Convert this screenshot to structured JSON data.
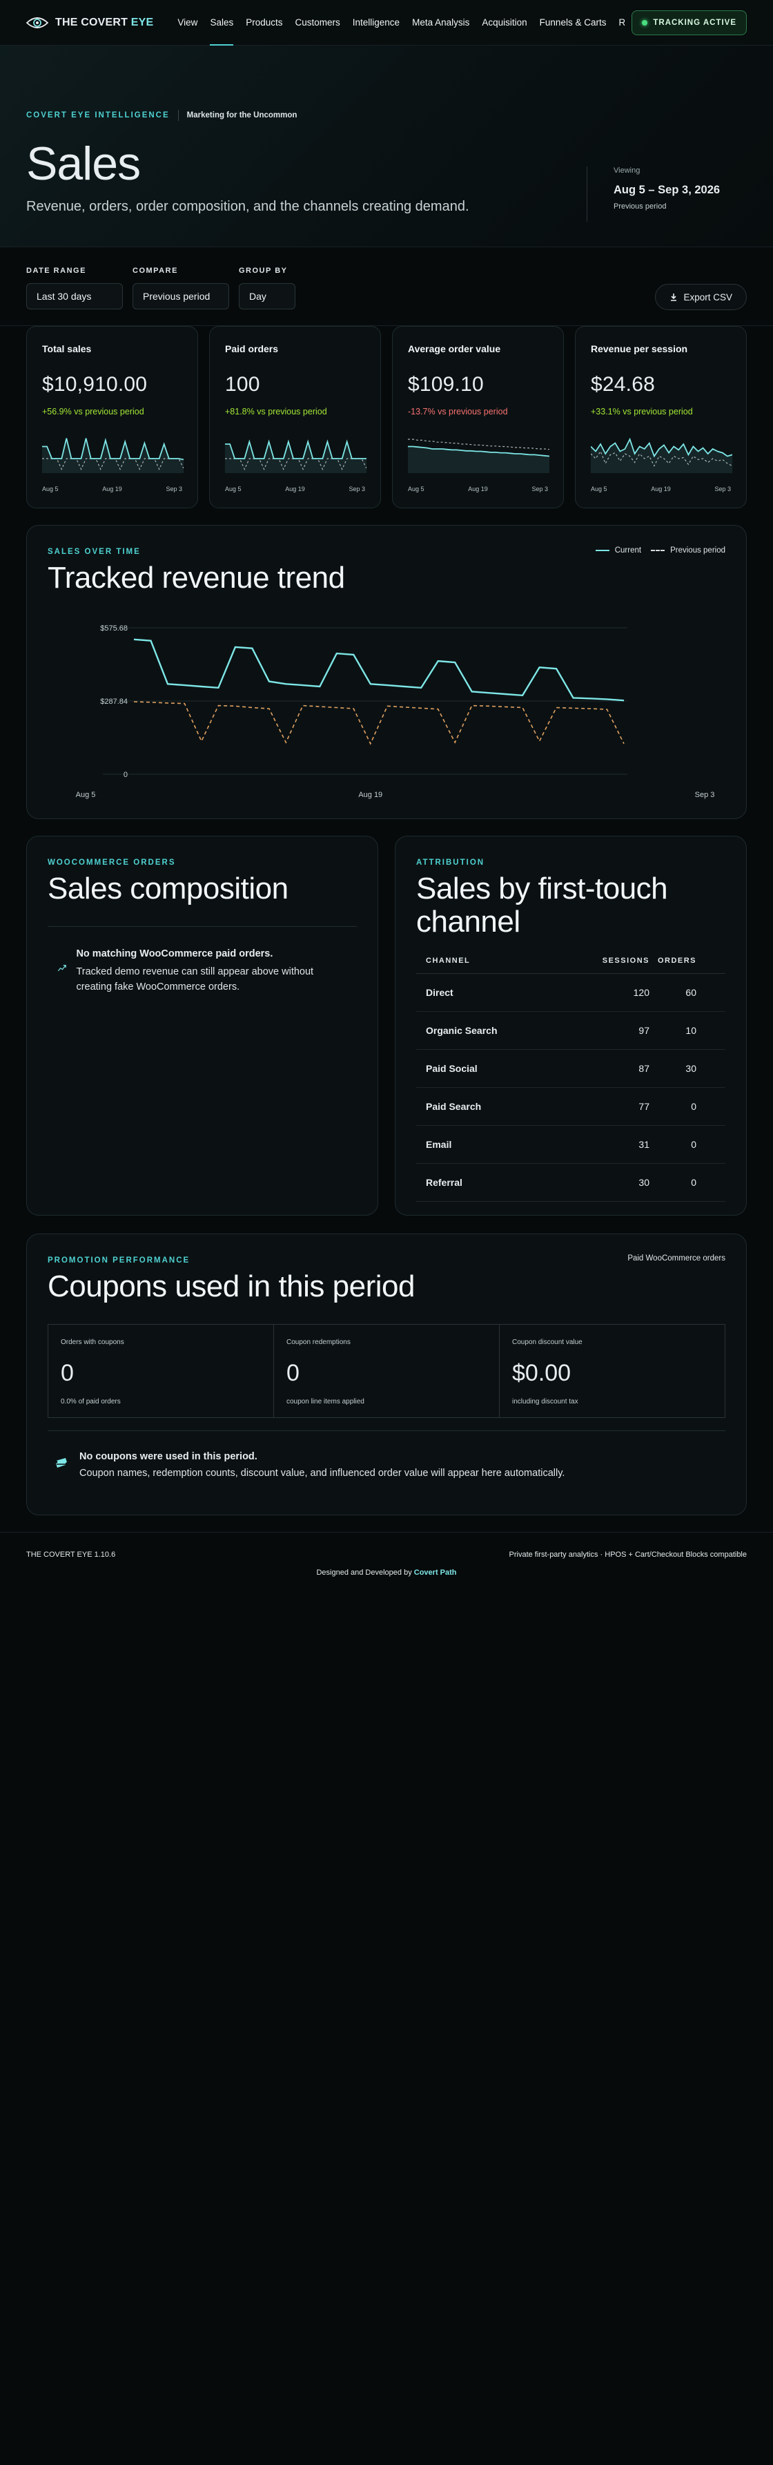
{
  "brand": {
    "name_a": "THE COVERT",
    "name_b": "EYE"
  },
  "nav": [
    "View",
    "Sales",
    "Products",
    "Customers",
    "Intelligence",
    "Meta Analysis",
    "Acquisition",
    "Funnels & Carts",
    "R"
  ],
  "nav_active": "Sales",
  "tracking_label": "TRACKING ACTIVE",
  "hero": {
    "eyebrow": "COVERT EYE INTELLIGENCE",
    "tagline": "Marketing for the Uncommon",
    "title": "Sales",
    "subtitle": "Revenue, orders, order composition, and the channels creating demand.",
    "viewing_label": "Viewing",
    "viewing_range": "Aug 5 – Sep 3, 2026",
    "viewing_compare": "Previous period"
  },
  "filters": {
    "date_range_label": "DATE RANGE",
    "date_range_value": "Last 30 days",
    "compare_label": "COMPARE",
    "compare_value": "Previous period",
    "group_by_label": "GROUP BY",
    "group_by_value": "Day",
    "export_label": "Export CSV"
  },
  "kpis": [
    {
      "title": "Total sales",
      "value": "$10,910.00",
      "delta": "+56.9% vs previous period",
      "trend": "up",
      "current": [
        0.55,
        0.55,
        0.3,
        0.3,
        0.3,
        0.72,
        0.3,
        0.3,
        0.3,
        0.72,
        0.3,
        0.3,
        0.3,
        0.68,
        0.3,
        0.3,
        0.3,
        0.65,
        0.3,
        0.3,
        0.3,
        0.62,
        0.3,
        0.3,
        0.3,
        0.6,
        0.3,
        0.3,
        0.3,
        0.28
      ],
      "previous": [
        0.3,
        0.3,
        0.3,
        0.3,
        0.08,
        0.3,
        0.3,
        0.3,
        0.08,
        0.3,
        0.3,
        0.3,
        0.08,
        0.3,
        0.3,
        0.3,
        0.08,
        0.3,
        0.3,
        0.3,
        0.08,
        0.3,
        0.3,
        0.3,
        0.08,
        0.3,
        0.3,
        0.3,
        0.3,
        0.1
      ]
    },
    {
      "title": "Paid orders",
      "value": "100",
      "delta": "+81.8% vs previous period",
      "trend": "up",
      "current": [
        0.6,
        0.6,
        0.3,
        0.3,
        0.3,
        0.65,
        0.3,
        0.3,
        0.3,
        0.65,
        0.3,
        0.3,
        0.3,
        0.65,
        0.3,
        0.3,
        0.3,
        0.65,
        0.3,
        0.3,
        0.3,
        0.65,
        0.3,
        0.3,
        0.3,
        0.65,
        0.3,
        0.3,
        0.3,
        0.3
      ],
      "previous": [
        0.3,
        0.3,
        0.3,
        0.3,
        0.08,
        0.3,
        0.3,
        0.3,
        0.08,
        0.3,
        0.3,
        0.3,
        0.08,
        0.3,
        0.3,
        0.3,
        0.08,
        0.3,
        0.3,
        0.3,
        0.08,
        0.3,
        0.3,
        0.3,
        0.08,
        0.3,
        0.3,
        0.3,
        0.3,
        0.1
      ]
    },
    {
      "title": "Average order value",
      "value": "$109.10",
      "delta": "-13.7% vs previous period",
      "trend": "down",
      "current": [
        0.55,
        0.55,
        0.54,
        0.53,
        0.52,
        0.5,
        0.5,
        0.5,
        0.49,
        0.48,
        0.48,
        0.47,
        0.46,
        0.46,
        0.45,
        0.45,
        0.44,
        0.43,
        0.43,
        0.42,
        0.42,
        0.41,
        0.4,
        0.4,
        0.39,
        0.38,
        0.38,
        0.37,
        0.36,
        0.35
      ],
      "previous": [
        0.7,
        0.7,
        0.68,
        0.68,
        0.66,
        0.66,
        0.64,
        0.64,
        0.63,
        0.62,
        0.62,
        0.6,
        0.6,
        0.59,
        0.58,
        0.58,
        0.57,
        0.56,
        0.56,
        0.55,
        0.55,
        0.54,
        0.53,
        0.53,
        0.52,
        0.52,
        0.51,
        0.5,
        0.5,
        0.49
      ]
    },
    {
      "title": "Revenue per session",
      "value": "$24.68",
      "delta": "+33.1% vs previous period",
      "trend": "up",
      "current": [
        0.55,
        0.45,
        0.6,
        0.4,
        0.55,
        0.62,
        0.45,
        0.5,
        0.7,
        0.4,
        0.55,
        0.5,
        0.62,
        0.35,
        0.5,
        0.58,
        0.42,
        0.55,
        0.48,
        0.6,
        0.38,
        0.55,
        0.45,
        0.52,
        0.4,
        0.5,
        0.45,
        0.42,
        0.35,
        0.38
      ],
      "previous": [
        0.4,
        0.3,
        0.45,
        0.2,
        0.38,
        0.42,
        0.25,
        0.4,
        0.35,
        0.22,
        0.4,
        0.3,
        0.35,
        0.15,
        0.35,
        0.3,
        0.2,
        0.35,
        0.3,
        0.32,
        0.18,
        0.35,
        0.28,
        0.3,
        0.22,
        0.3,
        0.25,
        0.28,
        0.2,
        0.15
      ]
    }
  ],
  "kpi_axis": [
    "Aug 5",
    "Aug 19",
    "Sep 3"
  ],
  "trend": {
    "label": "SALES OVER TIME",
    "title": "Tracked revenue trend",
    "legend_current": "Current",
    "legend_previous": "Previous period"
  },
  "chart_data": {
    "type": "line",
    "x": [
      "Aug 5",
      "Aug 6",
      "Aug 7",
      "Aug 8",
      "Aug 9",
      "Aug 10",
      "Aug 11",
      "Aug 12",
      "Aug 13",
      "Aug 14",
      "Aug 15",
      "Aug 16",
      "Aug 17",
      "Aug 18",
      "Aug 19",
      "Aug 20",
      "Aug 21",
      "Aug 22",
      "Aug 23",
      "Aug 24",
      "Aug 25",
      "Aug 26",
      "Aug 27",
      "Aug 28",
      "Aug 29",
      "Aug 30",
      "Aug 31",
      "Sep 1",
      "Sep 2",
      "Sep 3"
    ],
    "tick_labels": [
      "Aug 5",
      "Aug 19",
      "Sep 3"
    ],
    "y_ticks": [
      "0",
      "$287.84",
      "$575.68"
    ],
    "ylim": [
      0,
      575.68
    ],
    "series": [
      {
        "name": "Current",
        "color": "#7ee6e6",
        "values": [
          530,
          525,
          355,
          350,
          345,
          340,
          500,
          495,
          365,
          355,
          350,
          345,
          475,
          470,
          355,
          350,
          345,
          340,
          445,
          440,
          325,
          320,
          315,
          310,
          420,
          415,
          300,
          298,
          295,
          290
        ]
      },
      {
        "name": "Previous period",
        "color": "#e0a060",
        "values": [
          285,
          283,
          280,
          278,
          130,
          270,
          268,
          262,
          258,
          125,
          270,
          266,
          262,
          258,
          120,
          268,
          264,
          260,
          256,
          125,
          270,
          268,
          265,
          262,
          130,
          262,
          260,
          258,
          255,
          120
        ]
      }
    ]
  },
  "composition": {
    "label": "WOOCOMMERCE ORDERS",
    "title": "Sales composition",
    "empty_title": "No matching WooCommerce paid orders.",
    "empty_desc": "Tracked demo revenue can still appear above without creating fake WooCommerce orders."
  },
  "attribution": {
    "label": "ATTRIBUTION",
    "title": "Sales by first-touch channel",
    "headers": [
      "CHANNEL",
      "SESSIONS",
      "ORDERS"
    ],
    "rows": [
      {
        "channel": "Direct",
        "sessions": "120",
        "orders": "60"
      },
      {
        "channel": "Organic Search",
        "sessions": "97",
        "orders": "10"
      },
      {
        "channel": "Paid Social",
        "sessions": "87",
        "orders": "30"
      },
      {
        "channel": "Paid Search",
        "sessions": "77",
        "orders": "0"
      },
      {
        "channel": "Email",
        "sessions": "31",
        "orders": "0"
      },
      {
        "channel": "Referral",
        "sessions": "30",
        "orders": "0"
      }
    ]
  },
  "coupons": {
    "label": "PROMOTION PERFORMANCE",
    "scope": "Paid WooCommerce orders",
    "title": "Coupons used in this period",
    "stats": [
      {
        "label": "Orders with coupons",
        "value": "0",
        "note": "0.0% of paid orders"
      },
      {
        "label": "Coupon redemptions",
        "value": "0",
        "note": "coupon line items applied"
      },
      {
        "label": "Coupon discount value",
        "value": "$0.00",
        "note": "including discount tax"
      }
    ],
    "empty_title": "No coupons were used in this period.",
    "empty_desc": "Coupon names, redemption counts, discount value, and influenced order value will appear here automatically."
  },
  "footer": {
    "version": "THE COVERT EYE 1.10.6",
    "info": "Private first-party analytics · HPOS + Cart/Checkout Blocks compatible",
    "credit_prefix": "Designed and Developed by",
    "credit_name": "Covert Path"
  }
}
